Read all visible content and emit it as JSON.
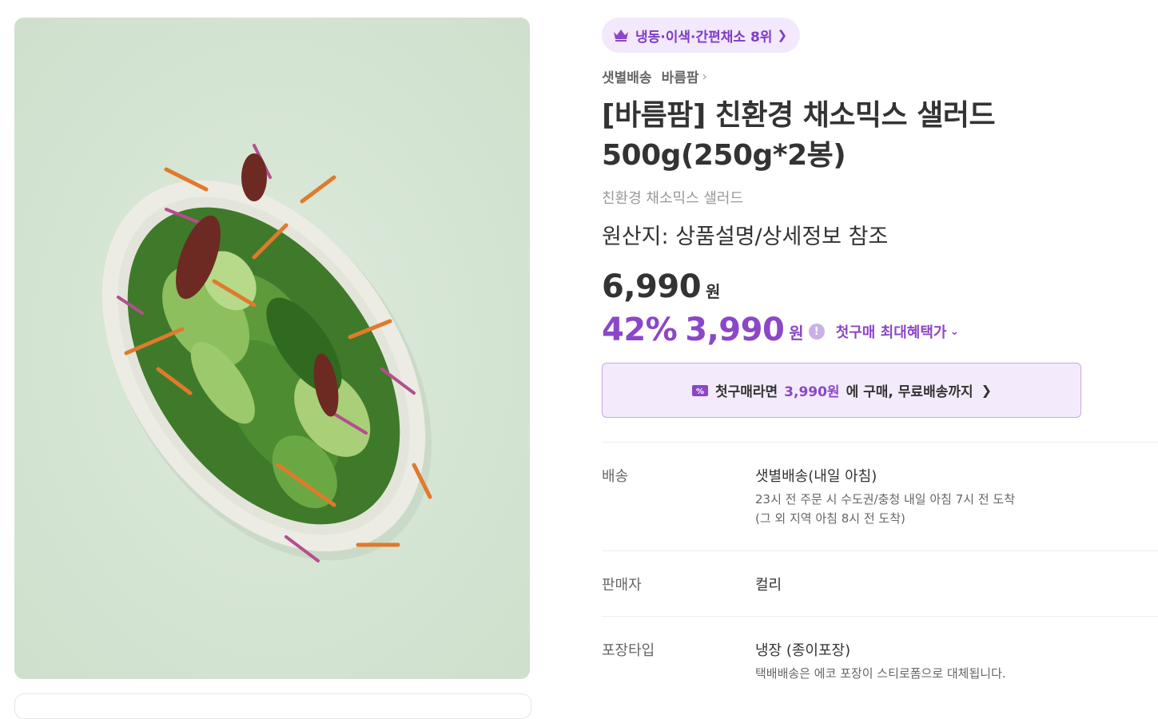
{
  "rank_badge": {
    "text": "냉동·이색·간편채소 8위",
    "icon": "crown-icon"
  },
  "breadcrumb": {
    "delivery_type": "샛별배송",
    "brand": "바름팜"
  },
  "product": {
    "title": "[바름팜] 친환경 채소믹스 샐러드 500g(250g*2봉)",
    "subtitle": "친환경 채소믹스 샐러드",
    "origin": "원산지: 상품설명/상세정보 참조"
  },
  "price": {
    "original": "6,990",
    "won": "원",
    "discount_rate": "42%",
    "sale": "3,990",
    "benefit_link": "첫구매 최대혜택가"
  },
  "coupon_banner": {
    "prefix": "첫구매라면 ",
    "highlight": "3,990원",
    "suffix": "에 구매, 무료배송까지"
  },
  "details": [
    {
      "label": "배송",
      "value": "샛별배송(내일 아침)",
      "desc1": "23시 전 주문 시 수도권/충청 내일 아침 7시 전 도착",
      "desc2": "(그 외 지역 아침 8시 전 도착)"
    },
    {
      "label": "판매자",
      "value": "컬리"
    },
    {
      "label": "포장타입",
      "value": "냉장 (종이포장)",
      "desc1": "택배배송은 에코 포장이 스티로폼으로 대체됩니다."
    }
  ],
  "colors": {
    "accent": "#8b47c7",
    "badge_bg": "#f3e8fc",
    "banner_bg": "#f3ebfc",
    "photo_bg": "#d7e6d6"
  }
}
